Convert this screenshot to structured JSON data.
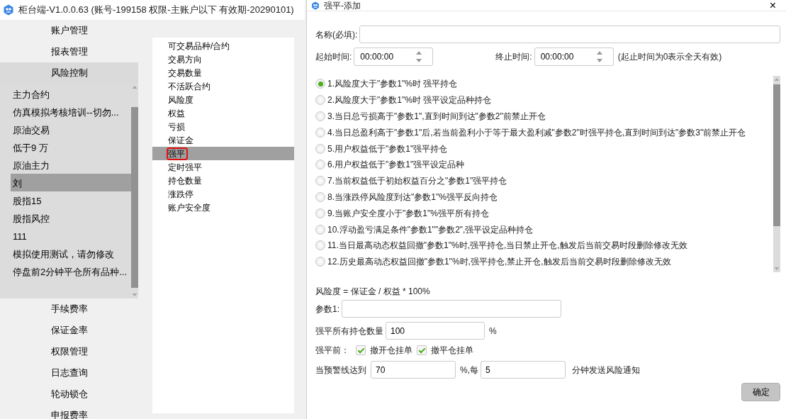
{
  "main_window": {
    "title": "柜台端-V1.0.0.63 (账号-199158 权限-主账户以下 有效期-20290101)"
  },
  "nav": [
    {
      "label": "账户管理",
      "selected": false
    },
    {
      "label": "报表管理",
      "selected": false
    },
    {
      "label": "风险控制",
      "selected": true,
      "children": [
        {
          "label": "主力合约",
          "selected": false
        },
        {
          "label": "仿真模拟考核培训--切勿...",
          "selected": false
        },
        {
          "label": "原油交易",
          "selected": false
        },
        {
          "label": "低于9 万",
          "selected": false
        },
        {
          "label": "原油主力",
          "selected": false
        },
        {
          "label": "刘",
          "selected": true
        },
        {
          "label": "股指15",
          "selected": false
        },
        {
          "label": "股指风控",
          "selected": false
        },
        {
          "label": "111",
          "selected": false
        },
        {
          "label": "模拟使用测试，请勿修改",
          "selected": false
        },
        {
          "label": "停盘前2分钟平仓所有品种...",
          "selected": false
        }
      ]
    },
    {
      "label": "手续费率",
      "selected": false
    },
    {
      "label": "保证金率",
      "selected": false
    },
    {
      "label": "权限管理",
      "selected": false
    },
    {
      "label": "日志查询",
      "selected": false
    },
    {
      "label": "轮动锁仓",
      "selected": false
    },
    {
      "label": "申报费率",
      "selected": false
    }
  ],
  "rule_types": [
    {
      "label": "可交易品种/合约",
      "selected": false
    },
    {
      "label": "交易方向",
      "selected": false
    },
    {
      "label": "交易数量",
      "selected": false
    },
    {
      "label": "不活跃合约",
      "selected": false
    },
    {
      "label": "风险度",
      "selected": false
    },
    {
      "label": "权益",
      "selected": false
    },
    {
      "label": "亏损",
      "selected": false
    },
    {
      "label": "保证金",
      "selected": false
    },
    {
      "label": "强平",
      "selected": true
    },
    {
      "label": "定时强平",
      "selected": false
    },
    {
      "label": "持仓数量",
      "selected": false
    },
    {
      "label": "涨跌停",
      "selected": false
    },
    {
      "label": "账户安全度",
      "selected": false
    }
  ],
  "dialog": {
    "title": "强平-添加",
    "close": "×",
    "name_label": "名称(必填):",
    "start_label": "起始时间:",
    "start_value": "00:00:00",
    "end_label": "终止时间:",
    "end_value": "00:00:00",
    "time_note": "(起止时间为0表示全天有效)",
    "options": [
      {
        "label": "1.风险度大于\"参数1\"%时 强平持仓",
        "selected": true
      },
      {
        "label": "2.风险度大于\"参数1\"%时 强平设定品种持仓",
        "selected": false
      },
      {
        "label": "3.当日总亏损高于\"参数1\",直到时间到达\"参数2\"前禁止开仓",
        "selected": false
      },
      {
        "label": "4.当日总盈利高于\"参数1\"后,若当前盈利小于等于最大盈利减\"参数2\"时强平持仓,直到时间到达\"参数3\"前禁止开仓",
        "selected": false
      },
      {
        "label": "5.用户权益低于\"参数1\"强平持仓",
        "selected": false
      },
      {
        "label": "6.用户权益低于\"参数1\"强平设定品种",
        "selected": false
      },
      {
        "label": "7.当前权益低于初始权益百分之\"参数1\"强平持仓",
        "selected": false
      },
      {
        "label": "8.当涨跌停风险度到达\"参数1\"%强平反向持仓",
        "selected": false
      },
      {
        "label": "9.当账户安全度小于\"参数1\"%强平所有持仓",
        "selected": false
      },
      {
        "label": "10.浮动盈亏满足条件\"参数1\"\"参数2\",强平设定品种持仓",
        "selected": false
      },
      {
        "label": "11.当日最高动态权益回撤\"参数1\"%时,强平持仓,当日禁止开仓,触发后当前交易时段删除修改无效",
        "selected": false
      },
      {
        "label": "12.历史最高动态权益回撤\"参数1\"%时,强平持仓,禁止开仓,触发后当前交易时段删除修改无效",
        "selected": false
      }
    ],
    "formula": "风险度 = 保证金 / 权益 * 100%",
    "param1_label": "参数1:",
    "qty_label": "强平所有持仓数量",
    "qty_value": "100",
    "qty_unit": "%",
    "before_label": "强平前：",
    "checks": [
      {
        "label": "撤开仓挂单",
        "checked": true
      },
      {
        "label": "撤平仓挂单",
        "checked": true
      }
    ],
    "warn_label": "当预警线达到",
    "warn_value": "70",
    "warn_mid": "%,每",
    "interval_value": "5",
    "interval_suffix": "分钟发送风险通知",
    "ok_button": "确定"
  }
}
